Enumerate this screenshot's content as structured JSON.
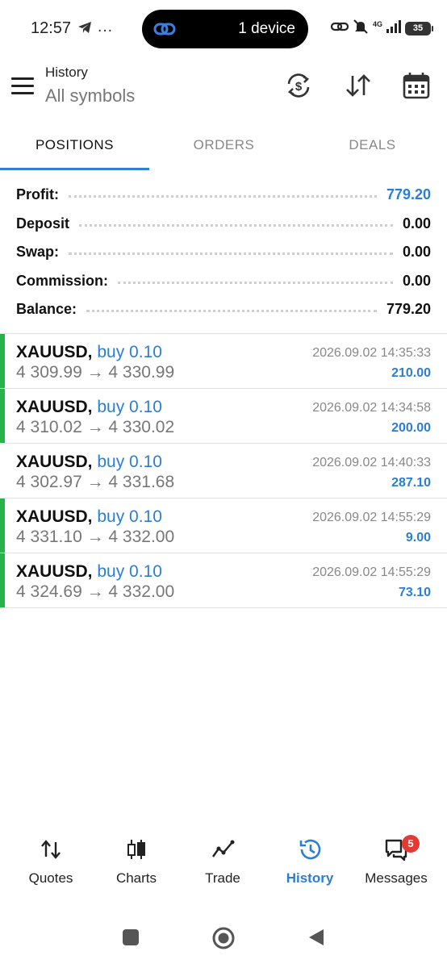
{
  "status_bar": {
    "time": "12:57",
    "dots": "…",
    "pill_label": "1 device",
    "network": "4G",
    "battery": "35"
  },
  "header": {
    "title": "History",
    "subtitle": "All symbols",
    "icons": [
      "sync-currency-icon",
      "sort-icon",
      "calendar-icon"
    ]
  },
  "tabs": [
    {
      "label": "POSITIONS",
      "active": true
    },
    {
      "label": "ORDERS",
      "active": false
    },
    {
      "label": "DEALS",
      "active": false
    }
  ],
  "summary": [
    {
      "label": "Profit:",
      "value": "779.20"
    },
    {
      "label": "Deposit",
      "value": "0.00"
    },
    {
      "label": "Swap:",
      "value": "0.00"
    },
    {
      "label": "Commission:",
      "value": "0.00"
    },
    {
      "label": "Balance:",
      "value": "779.20"
    }
  ],
  "positions": [
    {
      "symbol": "XAUUSD,",
      "side": "buy 0.10",
      "prices": "4 309.99 → 4 330.99",
      "date": "2026.09.02 14:35:33",
      "profit": "210.00",
      "marker": true
    },
    {
      "symbol": "XAUUSD,",
      "side": "buy 0.10",
      "prices": "4 310.02 → 4 330.02",
      "date": "2026.09.02 14:34:58",
      "profit": "200.00",
      "marker": true
    },
    {
      "symbol": "XAUUSD,",
      "side": "buy 0.10",
      "prices": "4 302.97 → 4 331.68",
      "date": "2026.09.02 14:40:33",
      "profit": "287.10",
      "marker": false
    },
    {
      "symbol": "XAUUSD,",
      "side": "buy 0.10",
      "prices": "4 331.10 → 4 332.00",
      "date": "2026.09.02 14:55:29",
      "profit": "9.00",
      "marker": true
    },
    {
      "symbol": "XAUUSD,",
      "side": "buy 0.10",
      "prices": "4 324.69 → 4 332.00",
      "date": "2026.09.02 14:55:29",
      "profit": "73.10",
      "marker": true
    }
  ],
  "bottom_nav": [
    {
      "label": "Quotes",
      "icon": "quotes-icon",
      "active": false
    },
    {
      "label": "Charts",
      "icon": "charts-icon",
      "active": false
    },
    {
      "label": "Trade",
      "icon": "trade-icon",
      "active": false
    },
    {
      "label": "History",
      "icon": "history-icon",
      "active": true
    },
    {
      "label": "Messages",
      "icon": "messages-icon",
      "active": false,
      "badge": "5"
    }
  ],
  "colors": {
    "accent": "#2a7fd4",
    "position_marker": "#27b34a",
    "badge": "#e23b36"
  }
}
